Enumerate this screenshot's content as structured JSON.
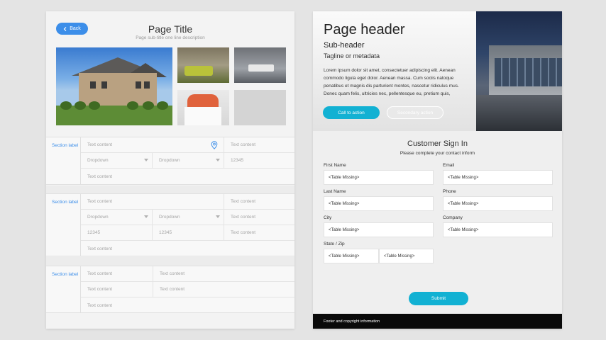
{
  "left": {
    "back_label": "Back",
    "page_title": "Page Title",
    "page_subtitle": "Page sub-title one line description",
    "sections": [
      {
        "label": "Section label",
        "rows": [
          [
            "Text content",
            "Text content"
          ],
          [
            "Dropdown",
            "Dropdown",
            "12345"
          ],
          [
            "Text content"
          ]
        ]
      },
      {
        "label": "Section label",
        "rows": [
          [
            "Text content",
            "Text content"
          ],
          [
            "Dropdown",
            "Dropdown",
            "Text content"
          ],
          [
            "12345",
            "12345",
            "Text content"
          ],
          [
            "Text content"
          ]
        ]
      },
      {
        "label": "Section label",
        "rows": [
          [
            "Text content",
            "Text content"
          ],
          [
            "Text content",
            "Text content"
          ],
          [
            "Text content"
          ]
        ]
      }
    ]
  },
  "right": {
    "hero": {
      "title": "Page header",
      "subheader": "Sub-header",
      "tagline": "Tagline or metadata",
      "body": "Lorem ipsum dolor sit amet, consectetuer adipiscing elit. Aenean commodo ligula eget dolor. Aenean massa. Cum sociis natoque penatibus et magnis dis parturient montes, nascetur ridiculus mus. Donec quam felis, ultricies nec, pellentesque eu, pretium quis,",
      "cta_label": "Call to action",
      "secondary_label": "Secondary action"
    },
    "signin": {
      "title": "Customer Sign In",
      "subtitle": "Please complete your contact inform",
      "fields": {
        "first_name": {
          "label": "First Name",
          "value": "<Table Missing>"
        },
        "email": {
          "label": "Email",
          "value": "<Table Missing>"
        },
        "last_name": {
          "label": "Last Name",
          "value": "<Table Missing>"
        },
        "phone": {
          "label": "Phone",
          "value": "<Table Missing>"
        },
        "city": {
          "label": "City",
          "value": "<Table Missing>"
        },
        "company": {
          "label": "Company",
          "value": "<Table Missing>"
        },
        "state_zip": {
          "label": "State / Zip",
          "state_value": "<Table Missing>",
          "zip_value": "<Table Missing>"
        }
      },
      "submit_label": "Submit"
    },
    "footer_text": "Footer and copyright information"
  },
  "colors": {
    "accent_blue": "#3c8ee9",
    "accent_cyan": "#12b1d3",
    "footer_bg": "#0a0a0a"
  },
  "icons": [
    "chevron-left-icon",
    "map-pin-icon",
    "caret-down-icon"
  ]
}
